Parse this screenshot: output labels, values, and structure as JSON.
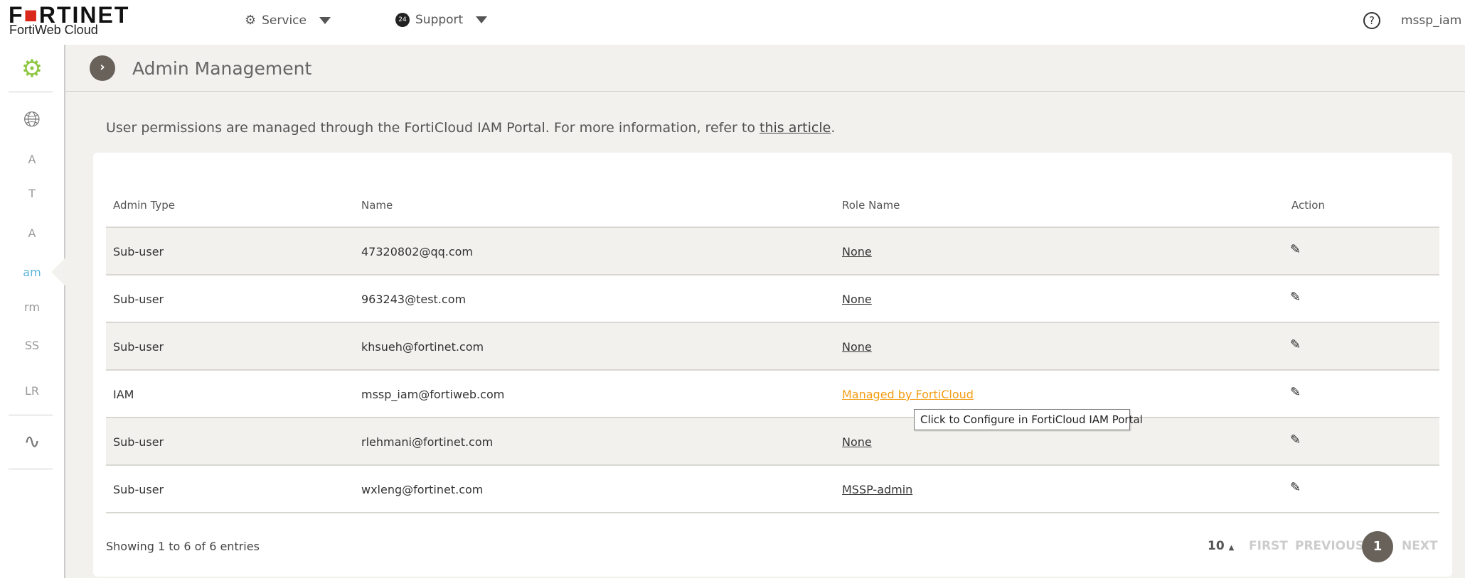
{
  "header": {
    "brand": "FORTINET",
    "product": "FortiWeb Cloud",
    "service_label": "Service",
    "support_label": "Support",
    "user_label": "mssp_iam"
  },
  "sidebar": {
    "items": [
      "A",
      "T",
      "A",
      "am",
      "rm",
      "SS",
      "LR"
    ],
    "active_index": 3
  },
  "page": {
    "title": "Admin Management",
    "info_text": "User permissions are managed through the FortiCloud IAM Portal. For more information, refer to ",
    "info_link": "this article",
    "info_end": "."
  },
  "table": {
    "columns": [
      "Admin Type",
      "Name",
      "Role Name",
      "Action"
    ],
    "rows": [
      {
        "type": "Sub-user",
        "name": "47320802@qq.com",
        "role": "None"
      },
      {
        "type": "Sub-user",
        "name": "963243@test.com",
        "role": "None"
      },
      {
        "type": "Sub-user",
        "name": "khsueh@fortinet.com",
        "role": "None"
      },
      {
        "type": "IAM",
        "name": "mssp_iam@fortiweb.com",
        "role": "Managed by FortiCloud"
      },
      {
        "type": "Sub-user",
        "name": "rlehmani@fortinet.com",
        "role": "None"
      },
      {
        "type": "Sub-user",
        "name": "wxleng@fortinet.com",
        "role": "MSSP-admin"
      }
    ],
    "tooltip": "Click to Configure in FortiCloud IAM Portal"
  },
  "footer": {
    "showing": "Showing 1 to 6 of 6 entries",
    "page_size": "10",
    "first": "FIRST",
    "previous": "PREVIOUS",
    "current_page": "1",
    "next": "NEXT"
  },
  "colors": {
    "accent_orange": "#f39c12",
    "active_blue": "#5bb5d9",
    "logo_red": "#da291c"
  }
}
